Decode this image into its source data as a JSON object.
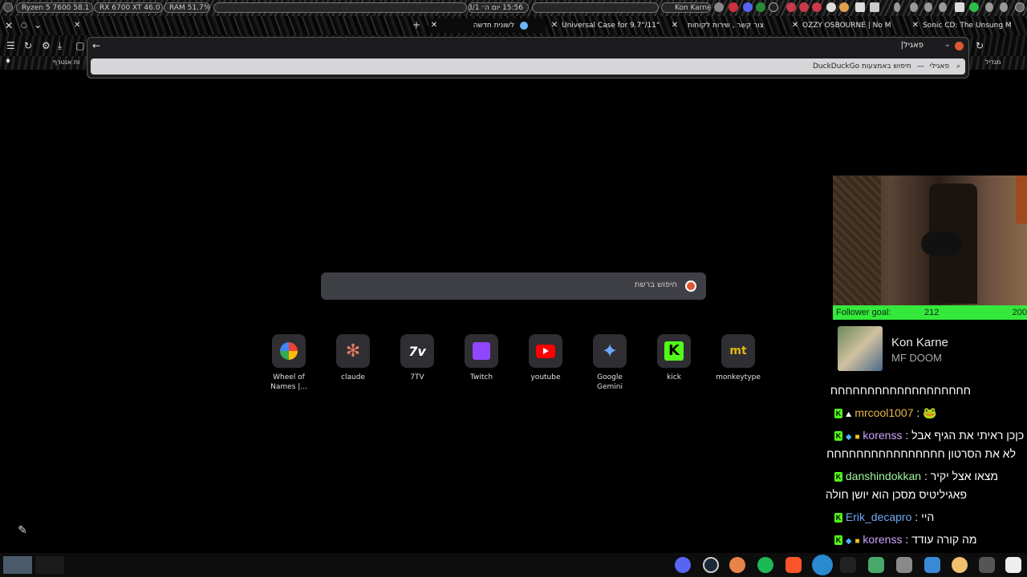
{
  "system_bar": {
    "cpu": "Ryzen 5 7600  58.1 °C",
    "gpu": "RX 6700 XT 46.0 °C",
    "ram": "RAM    51.7%",
    "clock": "15:56  יום ה׳ 3/1",
    "media": "Kon Karne"
  },
  "tabs": [
    {
      "label": "לשונית חדשה",
      "active": true
    },
    {
      "label": "Universal Case for 9.7\"/11\"",
      "active": false
    },
    {
      "label": "צור קשר , שירות לקוחות",
      "active": false
    },
    {
      "label": "OZZY OSBOURNE | No M",
      "active": false
    },
    {
      "label": "Sonic CD: The Unsung M",
      "active": false
    }
  ],
  "urlbar": {
    "value": "פאגיל|",
    "suggestion_query": "פאגילי",
    "suggestion_separator": "—",
    "suggestion_engine": "חיפוש באמצעות DuckDuckGo"
  },
  "bookmarks": {
    "left_item": "ות אנטרף",
    "right_item": "מגדיל"
  },
  "newtab": {
    "search_placeholder": "חיפוש ברשת",
    "shortcuts": [
      {
        "label": "Wheel of Names |...",
        "icon": "wheel-of-names-icon"
      },
      {
        "label": "claude",
        "icon": "claude-icon"
      },
      {
        "label": "7TV",
        "icon": "7tv-icon"
      },
      {
        "label": "Twitch",
        "icon": "twitch-icon"
      },
      {
        "label": "youtube",
        "icon": "youtube-icon"
      },
      {
        "label": "Google Gemini",
        "icon": "gemini-icon"
      },
      {
        "label": "kick",
        "icon": "kick-icon"
      },
      {
        "label": "monkeytype",
        "icon": "monkeytype-icon"
      }
    ]
  },
  "stream": {
    "goal_label": "Follower goal:",
    "goal_current": "212",
    "goal_target": "200",
    "now_playing_artist": "Kon Karne",
    "now_playing_song": "MF DOOM",
    "chat": [
      {
        "user": "",
        "message": "חחחחחחחחחחחחחחחחחחח"
      },
      {
        "user": "mrcool1007",
        "message": "🐸"
      },
      {
        "user": "korenss",
        "message": "כןכן ראיתי את הגיף אבל",
        "message2": "לא את הסרטון חחחחחחחחחחחחחחחח"
      },
      {
        "user": "danshindokkan",
        "message": "מצאו אצל יקיר",
        "message2": "פאגיליטיס מסכן הוא יושן חולה"
      },
      {
        "user": "Erik_decapro",
        "message": "היי"
      },
      {
        "user": "korenss",
        "message": "מה קורה עודד"
      }
    ]
  }
}
